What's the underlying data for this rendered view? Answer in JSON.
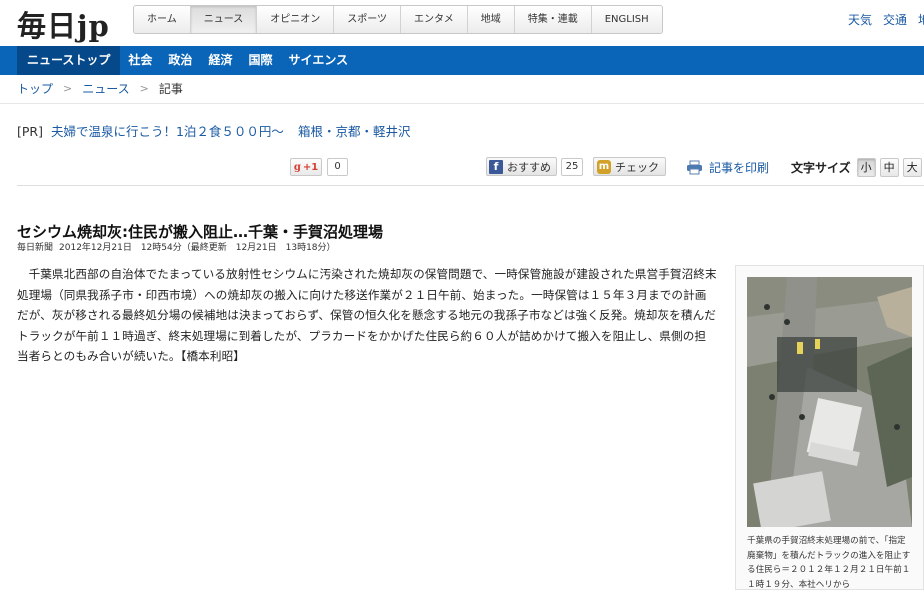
{
  "header": {
    "logo": "毎日jp",
    "nav": [
      {
        "label": "ホーム",
        "active": false
      },
      {
        "label": "ニュース",
        "active": true
      },
      {
        "label": "オピニオン",
        "active": false
      },
      {
        "label": "スポーツ",
        "active": false
      },
      {
        "label": "エンタメ",
        "active": false
      },
      {
        "label": "地域",
        "active": false
      },
      {
        "label": "特集・連載",
        "active": false
      },
      {
        "label": "ENGLISH",
        "active": false
      }
    ],
    "util_links": [
      "天気",
      "交通",
      "地"
    ]
  },
  "subnav": {
    "items": [
      "ニューストップ",
      "社会",
      "政治",
      "経済",
      "国際",
      "サイエンス"
    ],
    "active_index": 0,
    "color": "#0a64b8"
  },
  "breadcrumb": {
    "items": [
      "トップ",
      "ニュース"
    ],
    "separator": ">",
    "current": "記事"
  },
  "pr": {
    "tag": "[PR]",
    "link1": "夫婦で温泉に行こう！1泊２食５００円〜",
    "link2": "箱根・京都・軽井沢"
  },
  "share": {
    "gplus_label": "+1",
    "gplus_count": "0",
    "facebook_label": "おすすめ",
    "facebook_count": "25",
    "mixi_label": "チェック",
    "print_label": "記事を印刷",
    "fontsize_label": "文字サイズ",
    "fontsize_options": [
      "小",
      "中",
      "大"
    ],
    "fontsize_selected": "小"
  },
  "article": {
    "headline": "セシウム焼却灰:住民が搬入阻止…千葉・手賀沼処理場",
    "source": "毎日新聞",
    "date": "2012年12月21日　12時54分（最終更新　12月21日　13時18分）",
    "body": "千葉県北西部の自治体でたまっている放射性セシウムに汚染された焼却灰の保管問題で、一時保管施設が建設された県営手賀沼終末処理場（同県我孫子市・印西市境）への焼却灰の搬入に向けた移送作業が２１日午前、始まった。一時保管は１５年３月までの計画だが、灰が移される最終処分場の候補地は決まっておらず、保管の恒久化を懸念する地元の我孫子市などは強く反発。焼却灰を積んだトラックが午前１１時過ぎ、終末処理場に到着したが、プラカードをかかげた住民ら約６０人が詰めかけて搬入を阻止し、県側の担当者らとのもみ合いが続いた。【橋本利昭】"
  },
  "photo": {
    "caption": "千葉県の手賀沼終末処理場の前で、「指定廃棄物」を積んだトラックの進入を阻止する住民ら＝２０１２年１２月２１日午前１１時１９分、本社ヘリから"
  }
}
